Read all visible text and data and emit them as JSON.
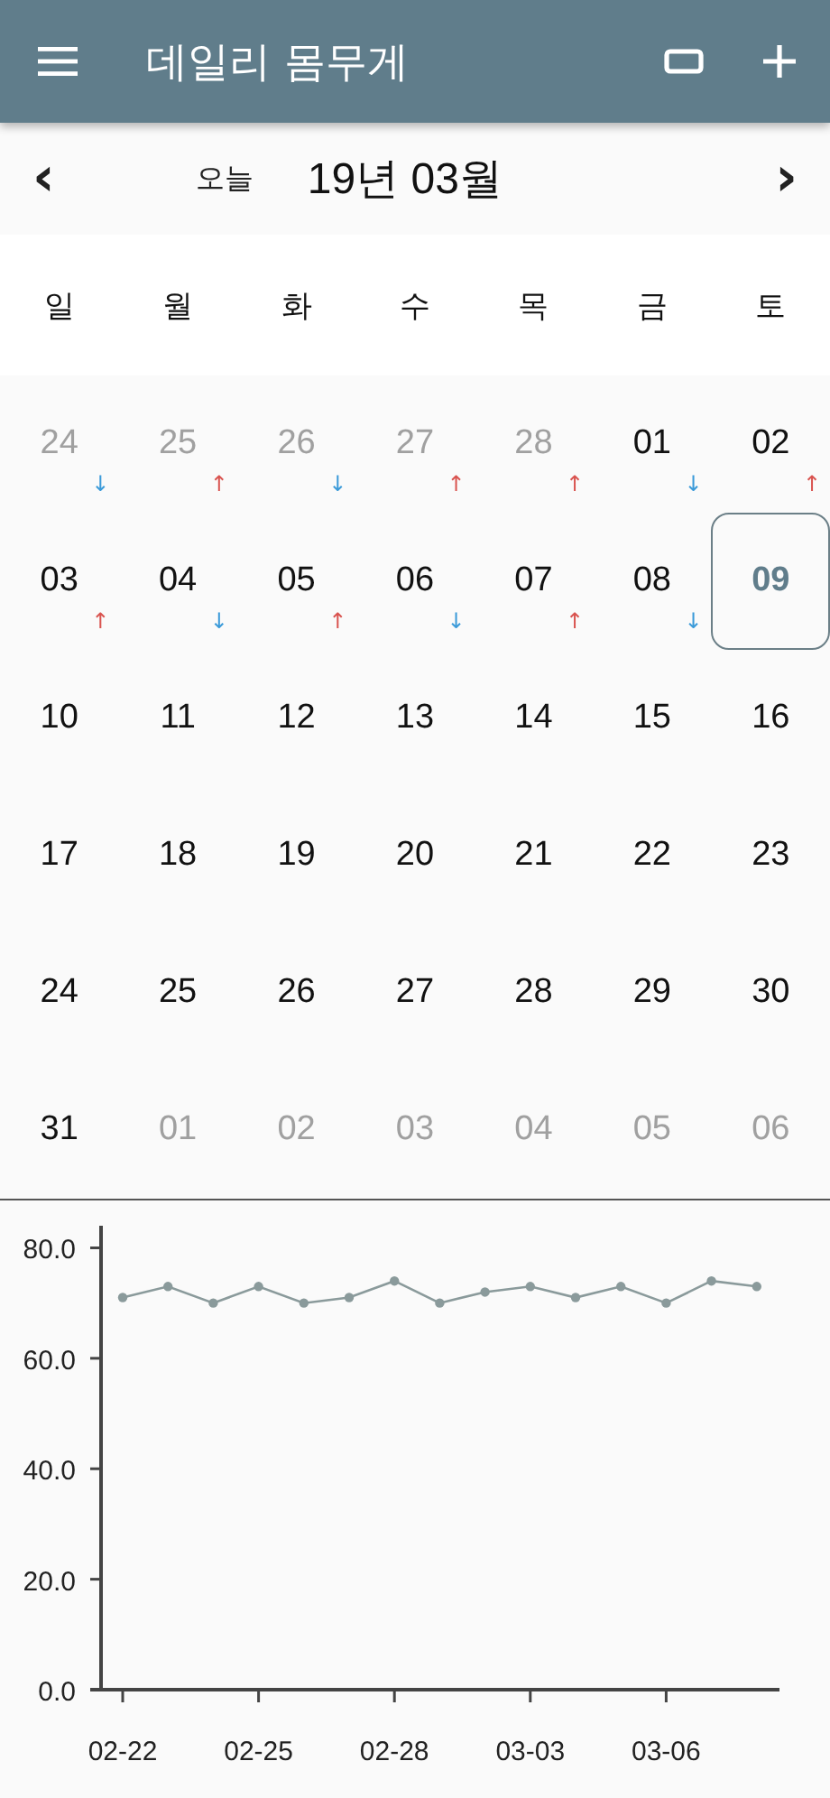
{
  "app_bar": {
    "title": "데일리 몸무게"
  },
  "nav": {
    "prev": "‹",
    "today": "오늘",
    "month": "19년 03월",
    "next": "›"
  },
  "weekdays": [
    "일",
    "월",
    "화",
    "수",
    "목",
    "금",
    "토"
  ],
  "weeks": [
    {
      "days": [
        {
          "day": "24",
          "other_month": true,
          "selected": false,
          "arrow": "↓",
          "color": "#3a9ad9"
        },
        {
          "day": "25",
          "other_month": true,
          "selected": false,
          "arrow": "↑",
          "color": "#d9534f"
        },
        {
          "day": "26",
          "other_month": true,
          "selected": false,
          "arrow": "↓",
          "color": "#3a9ad9"
        },
        {
          "day": "27",
          "other_month": true,
          "selected": false,
          "arrow": "↑",
          "color": "#d9534f"
        },
        {
          "day": "28",
          "other_month": true,
          "selected": false,
          "arrow": "↑",
          "color": "#d9534f"
        },
        {
          "day": "01",
          "other_month": false,
          "selected": false,
          "arrow": "↓",
          "color": "#3a9ad9"
        },
        {
          "day": "02",
          "other_month": false,
          "selected": false,
          "arrow": "↑",
          "color": "#d9534f"
        }
      ]
    },
    {
      "days": [
        {
          "day": "03",
          "other_month": false,
          "selected": false,
          "arrow": "↑",
          "color": "#d9534f"
        },
        {
          "day": "04",
          "other_month": false,
          "selected": false,
          "arrow": "↓",
          "color": "#3a9ad9"
        },
        {
          "day": "05",
          "other_month": false,
          "selected": false,
          "arrow": "↑",
          "color": "#d9534f"
        },
        {
          "day": "06",
          "other_month": false,
          "selected": false,
          "arrow": "↓",
          "color": "#3a9ad9"
        },
        {
          "day": "07",
          "other_month": false,
          "selected": false,
          "arrow": "↑",
          "color": "#d9534f"
        },
        {
          "day": "08",
          "other_month": false,
          "selected": false,
          "arrow": "↓",
          "color": "#3a9ad9"
        },
        {
          "day": "09",
          "other_month": false,
          "selected": true
        }
      ]
    },
    {
      "days": [
        {
          "day": "10",
          "other_month": false,
          "selected": false
        },
        {
          "day": "11",
          "other_month": false,
          "selected": false
        },
        {
          "day": "12",
          "other_month": false,
          "selected": false
        },
        {
          "day": "13",
          "other_month": false,
          "selected": false
        },
        {
          "day": "14",
          "other_month": false,
          "selected": false
        },
        {
          "day": "15",
          "other_month": false,
          "selected": false
        },
        {
          "day": "16",
          "other_month": false,
          "selected": false
        }
      ]
    },
    {
      "days": [
        {
          "day": "17",
          "other_month": false,
          "selected": false
        },
        {
          "day": "18",
          "other_month": false,
          "selected": false
        },
        {
          "day": "19",
          "other_month": false,
          "selected": false
        },
        {
          "day": "20",
          "other_month": false,
          "selected": false
        },
        {
          "day": "21",
          "other_month": false,
          "selected": false
        },
        {
          "day": "22",
          "other_month": false,
          "selected": false
        },
        {
          "day": "23",
          "other_month": false,
          "selected": false
        }
      ]
    },
    {
      "days": [
        {
          "day": "24",
          "other_month": false,
          "selected": false
        },
        {
          "day": "25",
          "other_month": false,
          "selected": false
        },
        {
          "day": "26",
          "other_month": false,
          "selected": false
        },
        {
          "day": "27",
          "other_month": false,
          "selected": false
        },
        {
          "day": "28",
          "other_month": false,
          "selected": false
        },
        {
          "day": "29",
          "other_month": false,
          "selected": false
        },
        {
          "day": "30",
          "other_month": false,
          "selected": false
        }
      ]
    },
    {
      "days": [
        {
          "day": "31",
          "other_month": false,
          "selected": false
        },
        {
          "day": "01",
          "other_month": true,
          "selected": false
        },
        {
          "day": "02",
          "other_month": true,
          "selected": false
        },
        {
          "day": "03",
          "other_month": true,
          "selected": false
        },
        {
          "day": "04",
          "other_month": true,
          "selected": false
        },
        {
          "day": "05",
          "other_month": true,
          "selected": false
        },
        {
          "day": "06",
          "other_month": true,
          "selected": false
        }
      ]
    }
  ],
  "chart": {
    "chart_data": {
      "type": "line",
      "categories": [
        "02-22",
        null,
        null,
        "02-25",
        null,
        null,
        "02-28",
        null,
        null,
        "03-03",
        null,
        null,
        "03-06",
        null,
        null
      ],
      "series": [
        {
          "color": "#8a9a9b",
          "marker": true,
          "values": [
            71,
            73,
            70,
            73,
            70,
            71,
            74,
            70,
            72,
            73,
            71,
            73,
            70,
            74,
            73
          ]
        }
      ],
      "ylim": [
        0,
        84
      ],
      "yticks": [
        {
          "value": 0,
          "label": "0.0"
        },
        {
          "value": 20,
          "label": "20.0"
        },
        {
          "value": 40,
          "label": "40.0"
        },
        {
          "value": 60,
          "label": "60.0"
        },
        {
          "value": 80,
          "label": "80.0"
        }
      ]
    }
  }
}
